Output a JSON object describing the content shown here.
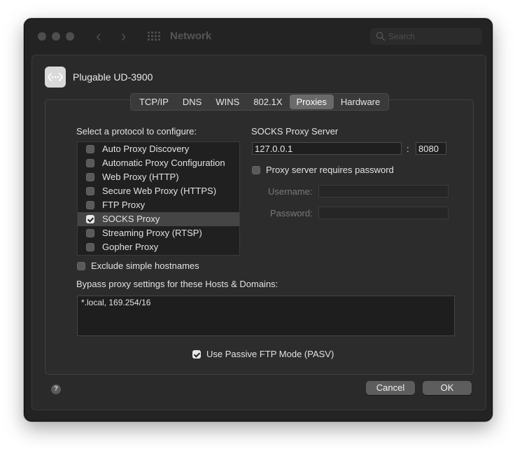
{
  "window": {
    "title": "Network",
    "search_placeholder": "Search"
  },
  "interface": {
    "name": "Plugable UD-3900",
    "icon": "ethernet-dots-icon"
  },
  "tabs": [
    {
      "label": "TCP/IP",
      "active": false
    },
    {
      "label": "DNS",
      "active": false
    },
    {
      "label": "WINS",
      "active": false
    },
    {
      "label": "802.1X",
      "active": false
    },
    {
      "label": "Proxies",
      "active": true
    },
    {
      "label": "Hardware",
      "active": false
    }
  ],
  "protocols": {
    "heading": "Select a protocol to configure:",
    "items": [
      {
        "label": "Auto Proxy Discovery",
        "checked": false,
        "selected": false
      },
      {
        "label": "Automatic Proxy Configuration",
        "checked": false,
        "selected": false
      },
      {
        "label": "Web Proxy (HTTP)",
        "checked": false,
        "selected": false
      },
      {
        "label": "Secure Web Proxy (HTTPS)",
        "checked": false,
        "selected": false
      },
      {
        "label": "FTP Proxy",
        "checked": false,
        "selected": false
      },
      {
        "label": "SOCKS Proxy",
        "checked": true,
        "selected": true
      },
      {
        "label": "Streaming Proxy (RTSP)",
        "checked": false,
        "selected": false
      },
      {
        "label": "Gopher Proxy",
        "checked": false,
        "selected": false
      }
    ]
  },
  "socks": {
    "heading": "SOCKS Proxy Server",
    "server": "127.0.0.1",
    "separator": ":",
    "port": "8080",
    "requires_password_label": "Proxy server requires password",
    "requires_password": false,
    "username_label": "Username:",
    "username": "",
    "password_label": "Password:",
    "password": ""
  },
  "exclude_simple_hostnames": {
    "label": "Exclude simple hostnames",
    "checked": false
  },
  "bypass": {
    "label": "Bypass proxy settings for these Hosts & Domains:",
    "value": "*.local, 169.254/16"
  },
  "passive_ftp": {
    "label": "Use Passive FTP Mode (PASV)",
    "checked": true
  },
  "buttons": {
    "help": "?",
    "cancel": "Cancel",
    "ok": "OK"
  },
  "colors": {
    "window_bg": "#232323",
    "sheet_bg": "#2a2a2a",
    "selected_row": "#454545"
  }
}
